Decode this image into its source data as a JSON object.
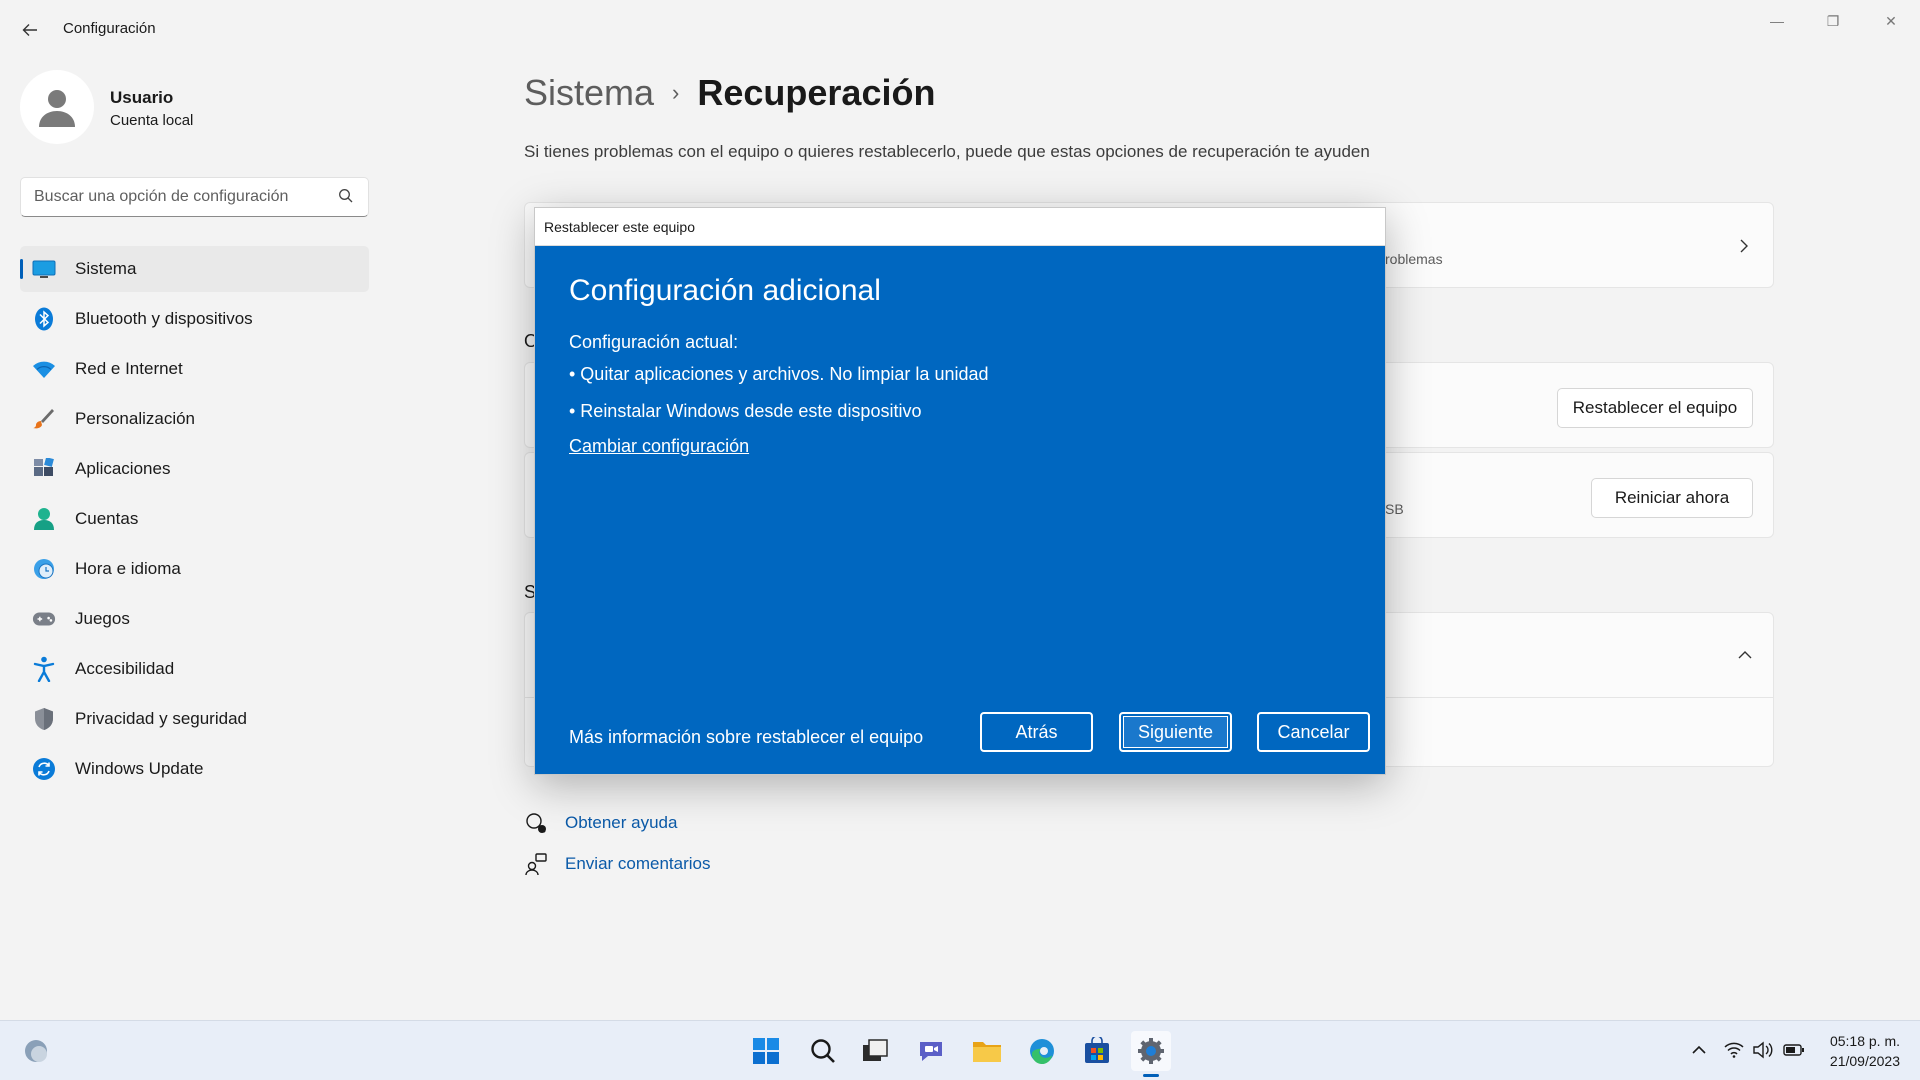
{
  "window": {
    "title": "Configuración",
    "controls": {
      "minimize": "—",
      "maximize": "❐",
      "close": "✕"
    }
  },
  "profile": {
    "name": "Usuario",
    "account_type": "Cuenta local"
  },
  "search": {
    "placeholder": "Buscar una opción de configuración"
  },
  "sidebar": {
    "items": [
      {
        "label": "Sistema",
        "icon": "system-icon",
        "active": true
      },
      {
        "label": "Bluetooth y dispositivos",
        "icon": "bluetooth-icon"
      },
      {
        "label": "Red e Internet",
        "icon": "wifi-icon"
      },
      {
        "label": "Personalización",
        "icon": "brush-icon"
      },
      {
        "label": "Aplicaciones",
        "icon": "apps-icon"
      },
      {
        "label": "Cuentas",
        "icon": "accounts-icon"
      },
      {
        "label": "Hora e idioma",
        "icon": "time-language-icon"
      },
      {
        "label": "Juegos",
        "icon": "gamepad-icon"
      },
      {
        "label": "Accesibilidad",
        "icon": "accessibility-icon"
      },
      {
        "label": "Privacidad y seguridad",
        "icon": "shield-icon"
      },
      {
        "label": "Windows Update",
        "icon": "windows-update-icon"
      }
    ]
  },
  "main": {
    "breadcrumb_parent": "Sistema",
    "breadcrumb_current": "Recuperación",
    "subtitle": "Si tienes problemas con el equipo o quieres restablecerlo, puede que estas opciones de recuperación te ayuden",
    "card1_fragment": "roblemas",
    "section1_letter": "O",
    "reset_button": "Restablecer el equipo",
    "card3_fragment": "SB",
    "restart_button": "Reiniciar ahora",
    "section2_letter": "S",
    "help_links": [
      {
        "label": "Obtener ayuda",
        "icon": "help-icon"
      },
      {
        "label": "Enviar comentarios",
        "icon": "feedback-icon"
      }
    ]
  },
  "dialog": {
    "window_title": "Restablecer este equipo",
    "heading": "Configuración adicional",
    "current_label": "Configuración actual:",
    "bullets": [
      "•  Quitar aplicaciones y archivos. No limpiar la unidad",
      "• Reinstalar Windows desde este dispositivo"
    ],
    "change_link": "Cambiar configuración",
    "more_info": "Más información sobre restablecer el equipo",
    "buttons": {
      "back": "Atrás",
      "next": "Siguiente",
      "cancel": "Cancelar"
    },
    "colors": {
      "background": "#0067c0"
    }
  },
  "taskbar": {
    "apps": [
      "start-icon",
      "search-icon",
      "task-view-icon",
      "chat-icon",
      "file-explorer-icon",
      "edge-icon",
      "store-icon",
      "settings-icon"
    ],
    "active_app": "settings-icon",
    "clock": {
      "time": "05:18 p. m.",
      "date": "21/09/2023"
    }
  },
  "colors": {
    "accent": "#005fb8",
    "link": "#0b5aa8"
  }
}
